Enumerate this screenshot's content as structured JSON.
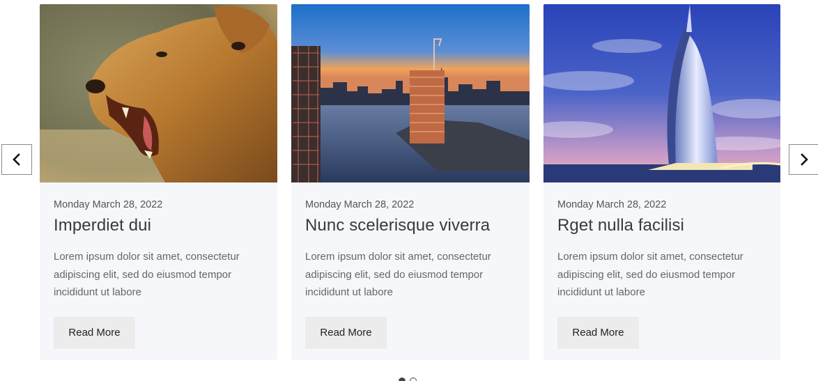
{
  "carousel": {
    "prev_icon": "chevron-left-icon",
    "next_icon": "chevron-right-icon",
    "dots": [
      {
        "active": true
      },
      {
        "active": false
      }
    ],
    "cards": [
      {
        "image_icon": "lioness-photo",
        "date": "Monday March 28, 2022",
        "title": "Imperdiet dui",
        "excerpt": "Lorem ipsum dolor sit amet, consectetur adipiscing elit, sed do eiusmod tempor incididunt ut labore",
        "button_label": "Read More"
      },
      {
        "image_icon": "city-skyline-photo",
        "date": "Monday March 28, 2022",
        "title": "Nunc scelerisque viverra",
        "excerpt": "Lorem ipsum dolor sit amet, consectetur adipiscing elit, sed do eiusmod tempor incididunt ut labore",
        "button_label": "Read More"
      },
      {
        "image_icon": "burj-al-arab-photo",
        "date": "Monday March 28, 2022",
        "title": "Rget nulla facilisi",
        "excerpt": "Lorem ipsum dolor sit amet, consectetur adipiscing elit, sed do eiusmod tempor incididunt ut labore",
        "button_label": "Read More"
      }
    ]
  }
}
